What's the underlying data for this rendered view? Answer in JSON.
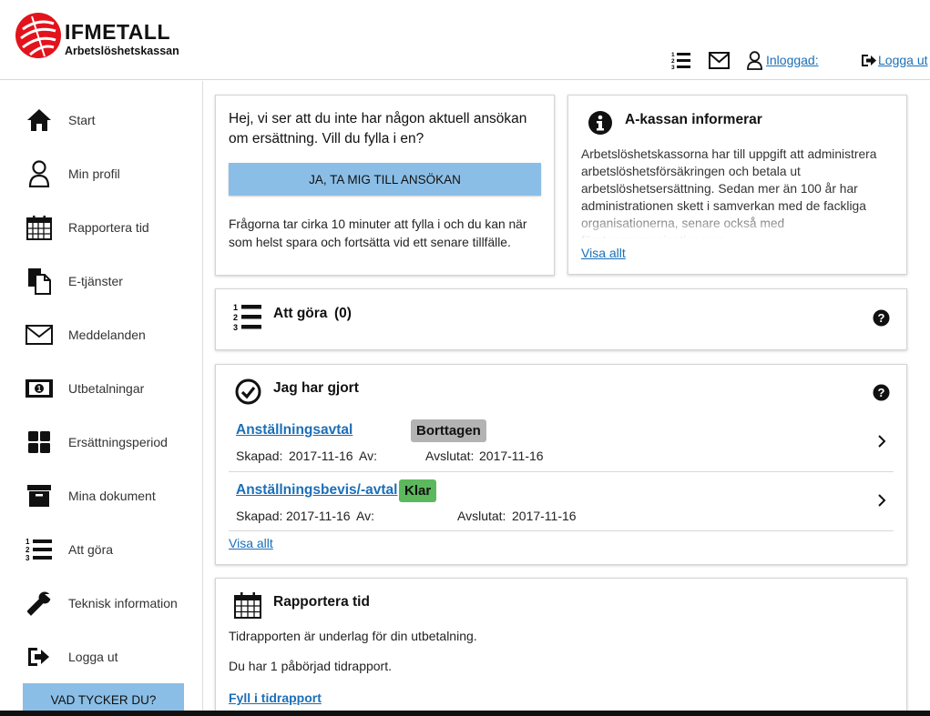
{
  "header": {
    "brand": "IFMETALL",
    "subtitle": "Arbetslöshetskassan",
    "logged_in_label": "Inloggad:",
    "logout_label": "Logga ut"
  },
  "sidebar": {
    "items": [
      {
        "label": "Start",
        "icon": "home-icon"
      },
      {
        "label": "Min profil",
        "icon": "user-icon"
      },
      {
        "label": "Rapportera tid",
        "icon": "calendar-icon"
      },
      {
        "label": "E-tjänster",
        "icon": "documents-icon"
      },
      {
        "label": "Meddelanden",
        "icon": "mail-icon"
      },
      {
        "label": "Utbetalningar",
        "icon": "money-icon"
      },
      {
        "label": "Ersättningsperiod",
        "icon": "grid-icon"
      },
      {
        "label": "Mina dokument",
        "icon": "archive-icon"
      },
      {
        "label": "Att göra",
        "icon": "list-icon"
      },
      {
        "label": "Teknisk information",
        "icon": "wrench-icon"
      },
      {
        "label": "Logga ut",
        "icon": "sign-out-icon"
      }
    ],
    "feedback_button": "VAD TYCKER DU?"
  },
  "apply_card": {
    "heading": "Hej, vi ser att du inte har någon aktuell ansökan om ersättning. Vill du fylla i en?",
    "button": "JA, TA MIG TILL ANSÖKAN",
    "note": "Frågorna tar cirka 10 minuter att fylla i och du kan när som helst spara och fortsätta vid ett senare tillfälle."
  },
  "info_card": {
    "title": "A-kassan informerar",
    "text": "Arbetslöshetskassorna har till uppgift att administrera arbetslöshetsförsäkringen och betala ut arbetslöshetsersättning. Sedan mer än 100 år har administrationen skett i samverkan med de fackliga organisationerna, senare också med företagarorganisationerna.",
    "show_all": "Visa allt"
  },
  "todo_card": {
    "title": "Att göra",
    "count": "(0)"
  },
  "done_card": {
    "title": "Jag har gjort",
    "items": [
      {
        "name": "Anställningsavtal",
        "status": "Borttagen",
        "created_label": "Skapad:",
        "created": "2017-11-16",
        "by_label": "Av:",
        "closed_label": "Avslutat:",
        "closed": "2017-11-16"
      },
      {
        "name": "Anställningsbevis/-avtal",
        "status": "Klar",
        "created_label": "Skapad:",
        "created": "2017-11-16",
        "by_label": "Av:",
        "closed_label": "Avslutat:",
        "closed": "2017-11-16"
      }
    ],
    "show_all": "Visa allt"
  },
  "report_card": {
    "title": "Rapportera tid",
    "line1": "Tidrapporten är underlag för din utbetalning.",
    "line2": "Du har 1 påbörjad tidrapport.",
    "link": "Fyll i tidrapport"
  },
  "colors": {
    "accent_button": "#8bbee6",
    "link": "#1b6fb8",
    "status_removed": "#b3b3b3",
    "status_done": "#5cb85c",
    "logo_red": "#e3131b"
  }
}
